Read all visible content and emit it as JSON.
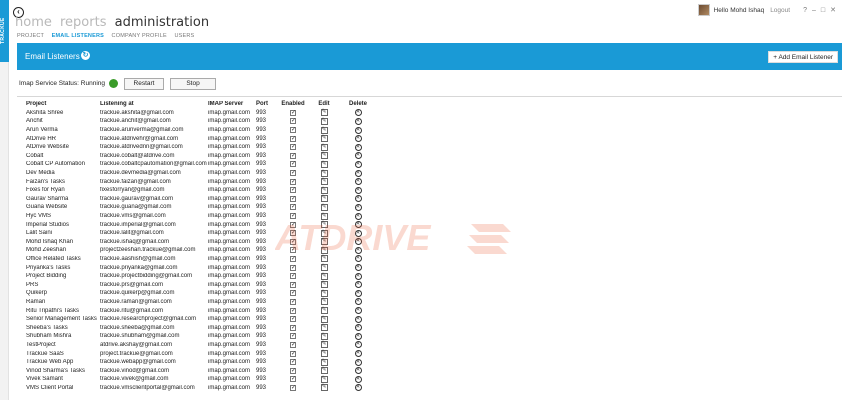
{
  "side_tab": {
    "label": "TRACKUE"
  },
  "top_nav": {
    "items": [
      "home",
      "reports",
      "administration"
    ]
  },
  "sub_nav": {
    "items": [
      "PROJECT",
      "EMAIL LISTENERS",
      "COMPANY PROFILE",
      "USERS"
    ]
  },
  "user": {
    "greeting": "Hello Mohd Ishaq",
    "logout": "Logout"
  },
  "window_controls": [
    "?",
    "–",
    "□",
    "✕"
  ],
  "panel": {
    "title": "Email Listeners",
    "add_button": "Add Email Listener"
  },
  "service": {
    "status_label": "Imap Service Status: Running",
    "status_color": "#3b9c2a",
    "restart": "Restart",
    "stop": "Stop"
  },
  "colors": {
    "accent": "#1a9ad6",
    "watermark": "#e8502a"
  },
  "watermark": {
    "text": "ATDRIVE"
  },
  "table": {
    "headers": [
      "Project",
      "Listening at",
      "IMAP Server",
      "Port",
      "Enabled",
      "Edit",
      "Delete"
    ],
    "rows": [
      {
        "project": "Akshita Shree",
        "email": "trackue.akshita@gmail.com",
        "server": "imap.gmail.com",
        "port": "993"
      },
      {
        "project": "Anchit",
        "email": "trackue.anchit@gmail.com",
        "server": "imap.gmail.com",
        "port": "993"
      },
      {
        "project": "Arun Verma",
        "email": "trackue.arunverma@gmail.com",
        "server": "imap.gmail.com",
        "port": "993"
      },
      {
        "project": "AtDrive HR",
        "email": "trackue.atdrivehr@gmail.com",
        "server": "imap.gmail.com",
        "port": "993"
      },
      {
        "project": "AtDrive Website",
        "email": "trackue.atdrivednn@gmail.com",
        "server": "imap.gmail.com",
        "port": "993"
      },
      {
        "project": "Cobalt",
        "email": "trackue.cobalt@atdrive.com",
        "server": "imap.gmail.com",
        "port": "993"
      },
      {
        "project": "Cobalt CP Automation",
        "email": "trackue.cobaltcpautomation@gmail.com",
        "server": "imap.gmail.com",
        "port": "993"
      },
      {
        "project": "Dev Media",
        "email": "trackue.devmedia@gmail.com",
        "server": "imap.gmail.com",
        "port": "993"
      },
      {
        "project": "Faizan's Tasks",
        "email": "trackue.faizan@gmail.com",
        "server": "imap.gmail.com",
        "port": "993"
      },
      {
        "project": "Fixes for Ryan",
        "email": "fixesforryan@gmail.com",
        "server": "imap.gmail.com",
        "port": "993"
      },
      {
        "project": "Gaurav Sharma",
        "email": "trackue.gaurav@gmail.com",
        "server": "imap.gmail.com",
        "port": "993"
      },
      {
        "project": "Guana Website",
        "email": "trackue.guana@gmail.com",
        "server": "imap.gmail.com",
        "port": "993"
      },
      {
        "project": "Hyc VMS",
        "email": "trackue.vms@gmail.com",
        "server": "imap.gmail.com",
        "port": "993"
      },
      {
        "project": "Imperial Studios",
        "email": "trackue.imperial@gmail.com",
        "server": "imap.gmail.com",
        "port": "993"
      },
      {
        "project": "Lalit Saini",
        "email": "trackue.lalit@gmail.com",
        "server": "imap.gmail.com",
        "port": "993"
      },
      {
        "project": "Mohd Ishaq Khan",
        "email": "trackue.ishaq@gmail.com",
        "server": "imap.gmail.com",
        "port": "993"
      },
      {
        "project": "Mohd Zeeshan",
        "email": "projectzeeshan.trackue@gmail.com",
        "server": "imap.gmail.com",
        "port": "993"
      },
      {
        "project": "Office Related Tasks",
        "email": "trackue.aashish@gmail.com",
        "server": "imap.gmail.com",
        "port": "993"
      },
      {
        "project": "Priyanka's Tasks",
        "email": "trackue.priyanka@gmail.com",
        "server": "imap.gmail.com",
        "port": "993"
      },
      {
        "project": "Project Bidding",
        "email": "trackue.projectbidding@gmail.com",
        "server": "imap.gmail.com",
        "port": "993"
      },
      {
        "project": "PRS",
        "email": "trackue.prs@gmail.com",
        "server": "imap.gmail.com",
        "port": "993"
      },
      {
        "project": "Quikerp",
        "email": "trackue.quikerp@gmail.com",
        "server": "imap.gmail.com",
        "port": "993"
      },
      {
        "project": "Raman",
        "email": "trackue.raman@gmail.com",
        "server": "imap.gmail.com",
        "port": "993"
      },
      {
        "project": "Ritu Tripathi's Tasks",
        "email": "trackue.ritu@gmail.com",
        "server": "imap.gmail.com",
        "port": "993"
      },
      {
        "project": "Senior Management Tasks",
        "email": "trackue.researchproject@gmail.com",
        "server": "imap.gmail.com",
        "port": "993"
      },
      {
        "project": "Sheeba's Tasks",
        "email": "trackue.sheeba@gmail.com",
        "server": "imap.gmail.com",
        "port": "993"
      },
      {
        "project": "Shubham Mishra",
        "email": "trackue.shubham@gmail.com",
        "server": "imap.gmail.com",
        "port": "993"
      },
      {
        "project": "TestProject",
        "email": "atdrive.akshay@gmail.com",
        "server": "imap.gmail.com",
        "port": "993"
      },
      {
        "project": "Trackue SaaS",
        "email": "project.trackue@gmail.com",
        "server": "imap.gmail.com",
        "port": "993"
      },
      {
        "project": "Trackue Web App",
        "email": "trackue.webapp@gmail.com",
        "server": "imap.gmail.com",
        "port": "993"
      },
      {
        "project": "Vinod Sharma's Tasks",
        "email": "trackue.vinod@gmail.com",
        "server": "imap.gmail.com",
        "port": "993"
      },
      {
        "project": "Vivek Samant",
        "email": "trackue.vivek@gmail.com",
        "server": "imap.gmail.com",
        "port": "993"
      },
      {
        "project": "VMS Client Portal",
        "email": "trackue.vmsclientportal@gmail.com",
        "server": "imap.gmail.com",
        "port": "993"
      }
    ]
  }
}
